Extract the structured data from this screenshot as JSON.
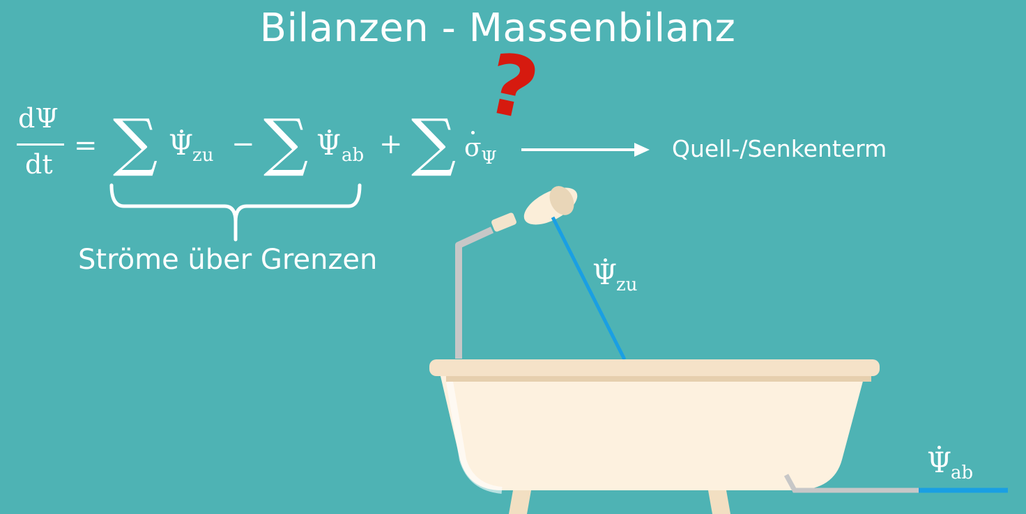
{
  "title": "Bilanzen - Massenbilanz",
  "equation": {
    "numerator": "dΨ",
    "denominator": "dt",
    "equals": "=",
    "minus": "−",
    "plus": "+",
    "psi": "Ψ",
    "sigma": "σ",
    "sub_zu": "zu",
    "sub_ab": "ab",
    "sub_psi": "Ψ",
    "sum": "∑"
  },
  "question_mark": "?",
  "annotation_source": "Quell-/Senkenterm",
  "annotation_flows": "Ströme über Grenzen",
  "bathtub": {
    "inflow_symbol": "Ψ",
    "inflow_sub": "zu",
    "outflow_symbol": "Ψ",
    "outflow_sub": "ab"
  },
  "colors": {
    "background": "#4eb3b4",
    "water": "#1a9fe3",
    "tub": "#fdf1df",
    "pipe": "#c4c4c4",
    "question": "#d61a0f"
  }
}
